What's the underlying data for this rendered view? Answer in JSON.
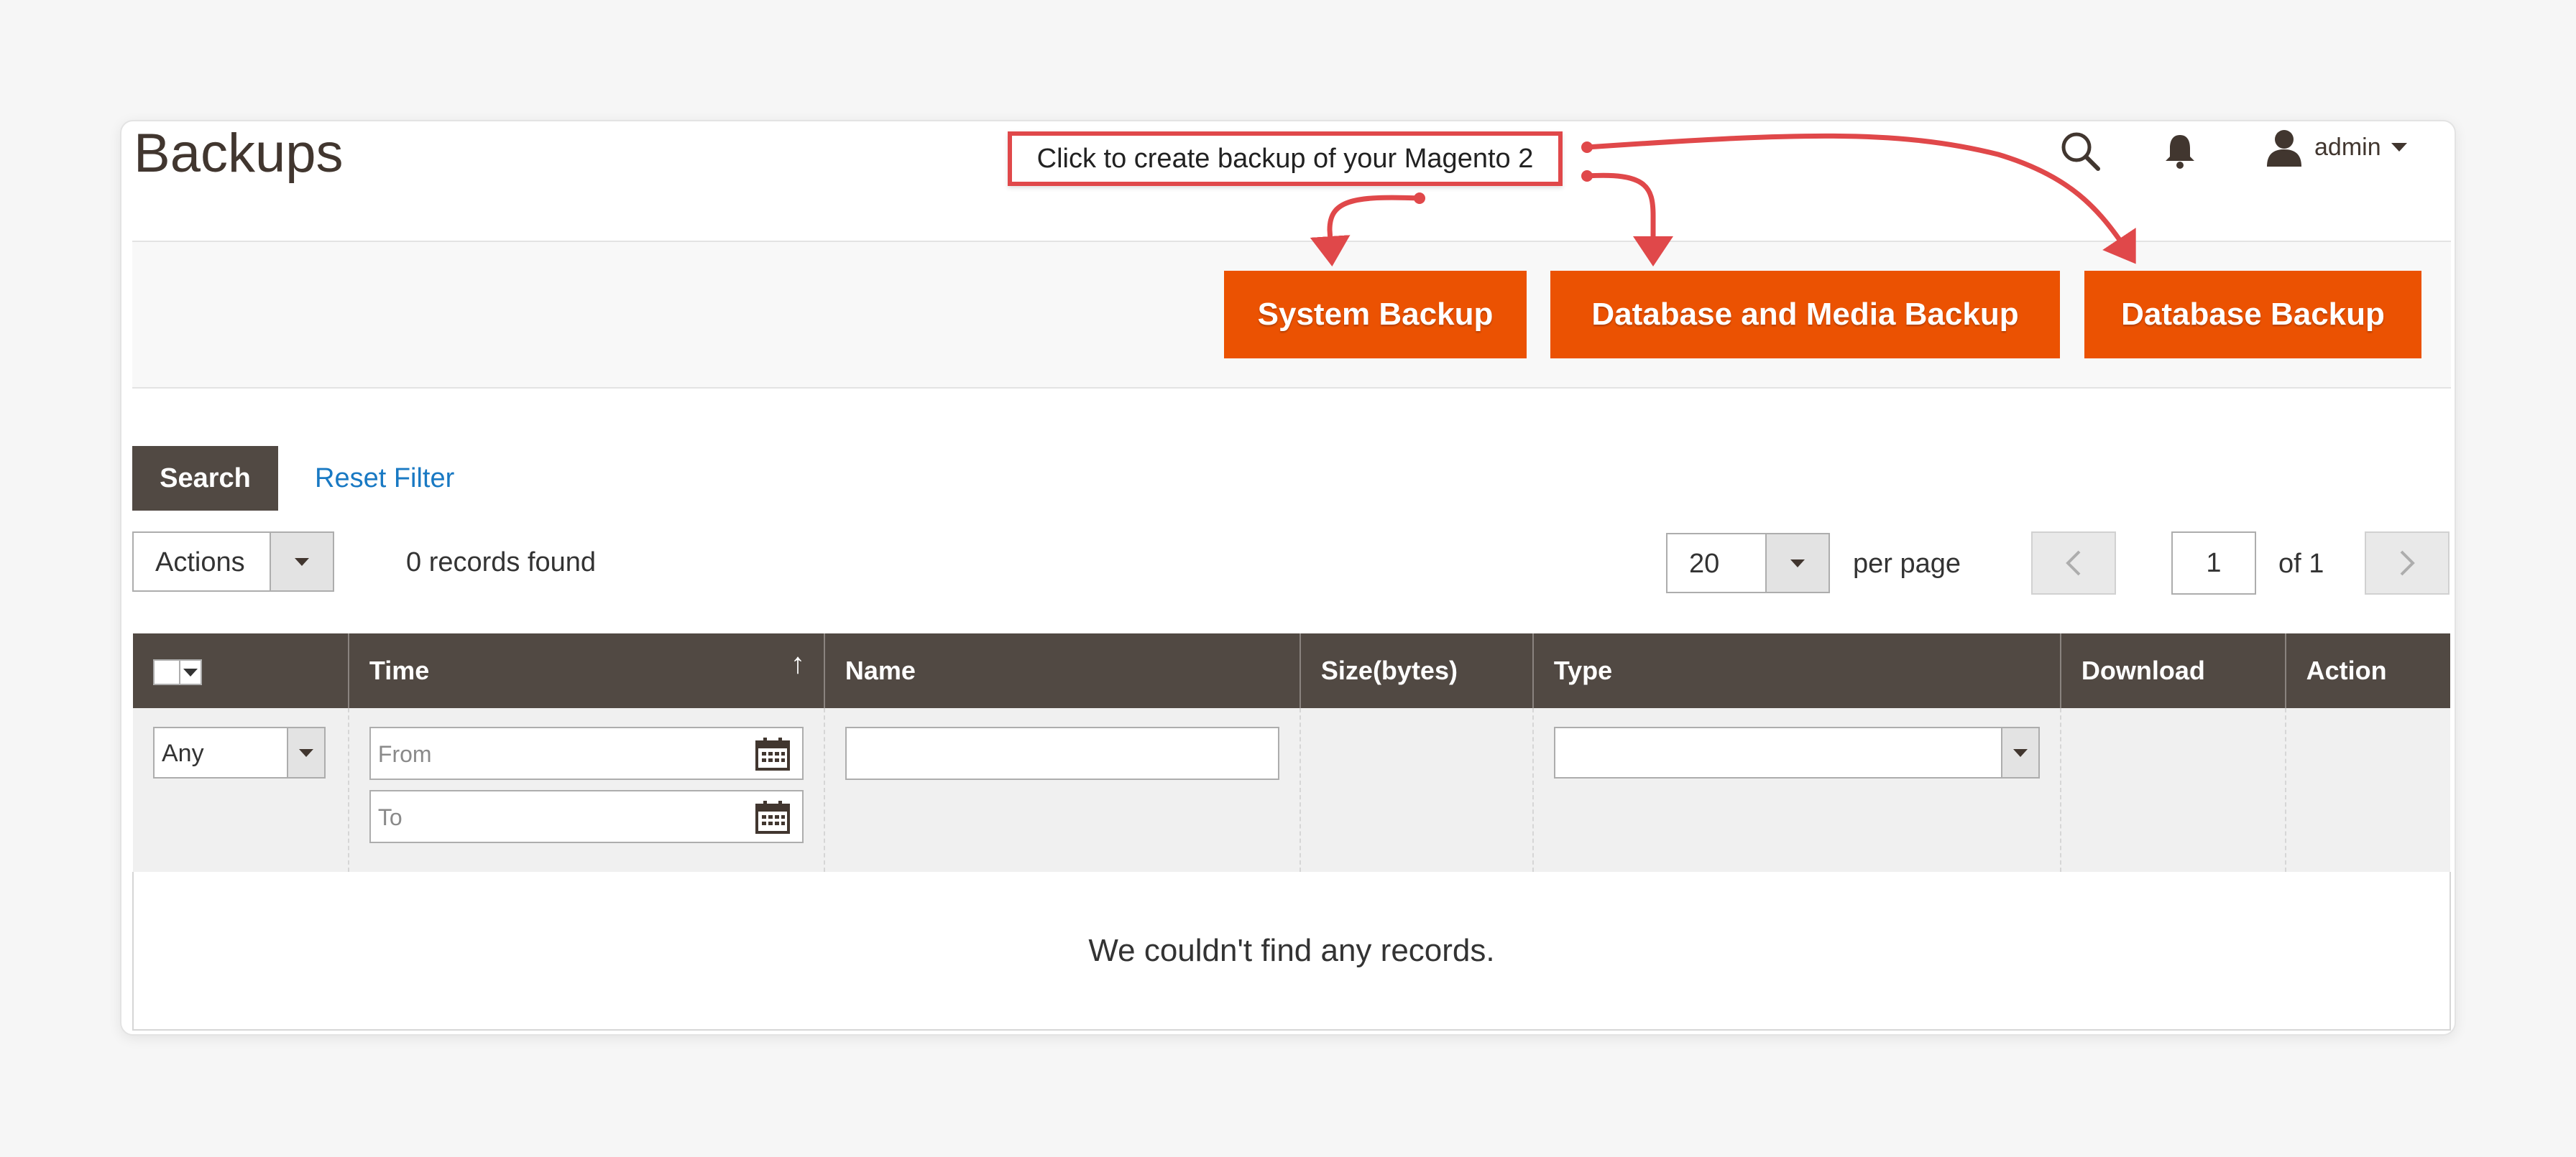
{
  "header": {
    "title": "Backups",
    "callout": "Click to create backup of your Magento 2",
    "user": "admin"
  },
  "toolbar_buttons": {
    "system_backup": "System Backup",
    "db_media_backup": "Database and Media Backup",
    "db_backup": "Database Backup"
  },
  "filters_bar": {
    "search_label": "Search",
    "reset_label": "Reset Filter",
    "actions_label": "Actions",
    "records_found": "0 records found",
    "per_page_value": "20",
    "per_page_label": "per page",
    "page_current": "1",
    "page_total": "of 1"
  },
  "grid": {
    "columns": [
      "Time",
      "Name",
      "Size(bytes)",
      "Type",
      "Download",
      "Action"
    ],
    "sort_indicator": "↑",
    "filter_any": "Any",
    "filter_from_placeholder": "From",
    "filter_to_placeholder": "To",
    "empty_message": "We couldn't find any records."
  },
  "colors": {
    "accent": "#eb5202",
    "header_dark": "#514943",
    "annotation_red": "#e0484a",
    "link_blue": "#1979c3"
  },
  "icons": [
    "search-icon",
    "bell-icon",
    "user-icon",
    "calendar-icon",
    "chevron-left-icon",
    "chevron-right-icon"
  ]
}
